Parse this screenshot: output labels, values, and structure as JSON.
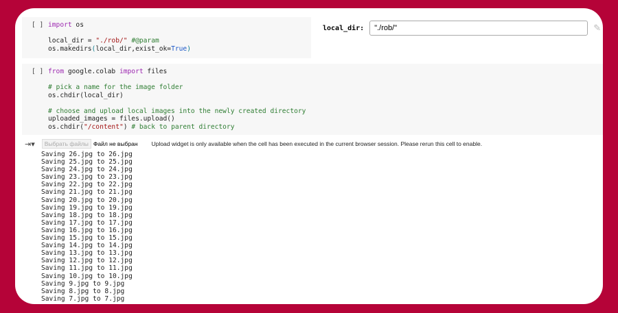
{
  "cell1": {
    "run_label": "[ ]",
    "lines": [
      [
        "import",
        "os"
      ],
      [
        "local_dir = ",
        "\"./rob/\"",
        "#@param"
      ],
      [
        "os.makedirs(local_dir,exist_ok=True)"
      ]
    ],
    "form_label": "local_dir:",
    "form_value": "\"./rob/\""
  },
  "cell2": {
    "run_label": "[ ]",
    "line1_kw1": "from",
    "line1_mod": " google.colab ",
    "line1_kw2": "import",
    "line1_rest": " files",
    "comment1": "# pick a name for the image folder",
    "line_chdir": "os.chdir(local_dir)",
    "comment2": "# choose and upload local images into the newly created directory",
    "line_upload": "uploaded_images = files.upload()",
    "line_back_pre": "os.chdir(",
    "line_back_str": "\"/content\"",
    "line_back_post": ") ",
    "line_back_cm": "# back to parent directory"
  },
  "output": {
    "choose_button": "Выбрать файлы",
    "no_file": "Файл не выбран",
    "message": "Upload widget is only available when the cell has been executed in the current browser session. Please rerun this cell to enable.",
    "lines": [
      "Saving 26.jpg to 26.jpg",
      "Saving 25.jpg to 25.jpg",
      "Saving 24.jpg to 24.jpg",
      "Saving 23.jpg to 23.jpg",
      "Saving 22.jpg to 22.jpg",
      "Saving 21.jpg to 21.jpg",
      "Saving 20.jpg to 20.jpg",
      "Saving 19.jpg to 19.jpg",
      "Saving 18.jpg to 18.jpg",
      "Saving 17.jpg to 17.jpg",
      "Saving 16.jpg to 16.jpg",
      "Saving 15.jpg to 15.jpg",
      "Saving 14.jpg to 14.jpg",
      "Saving 13.jpg to 13.jpg",
      "Saving 12.jpg to 12.jpg",
      "Saving 11.jpg to 11.jpg",
      "Saving 10.jpg to 10.jpg",
      "Saving 9.jpg to 9.jpg",
      "Saving 8.jpg to 8.jpg",
      "Saving 7.jpg to 7.jpg"
    ]
  }
}
